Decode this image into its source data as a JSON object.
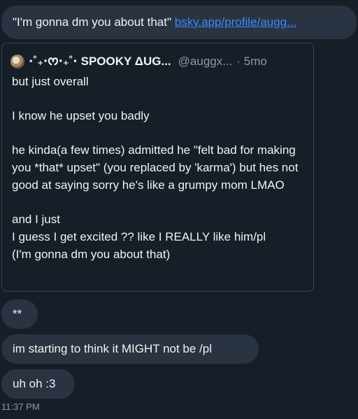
{
  "top_message": {
    "text": "\"I'm gonna dm you about that\" ",
    "link": "bsky.app/profile/augg..."
  },
  "quote": {
    "author_name": "⋅˚₊‧ᰔ‧₊˚⋅ SPOOKY ΔUG...",
    "handle": "@auggx...",
    "time": "· 5mo",
    "lines": [
      "but just overall",
      "",
      "I know he upset you badly",
      "",
      "he kinda(a few times) admitted he \"felt bad for making you *that* upset\" (you replaced by 'karma') but hes not good at saying sorry he's like a grumpy mom LMAO",
      "",
      "and I just",
      "I guess I get excited ?? like I REALLY like him/pl",
      "(I'm gonna dm you about that)"
    ]
  },
  "messages": [
    {
      "text": "**"
    },
    {
      "text": "im starting to think it MIGHT not be /pl"
    },
    {
      "text": "uh oh :3"
    }
  ],
  "timestamp": "11:37 PM",
  "colors": {
    "background": "#161e27",
    "bubble": "#2a3341",
    "link": "#3a8af7",
    "muted": "#8c99aa"
  }
}
